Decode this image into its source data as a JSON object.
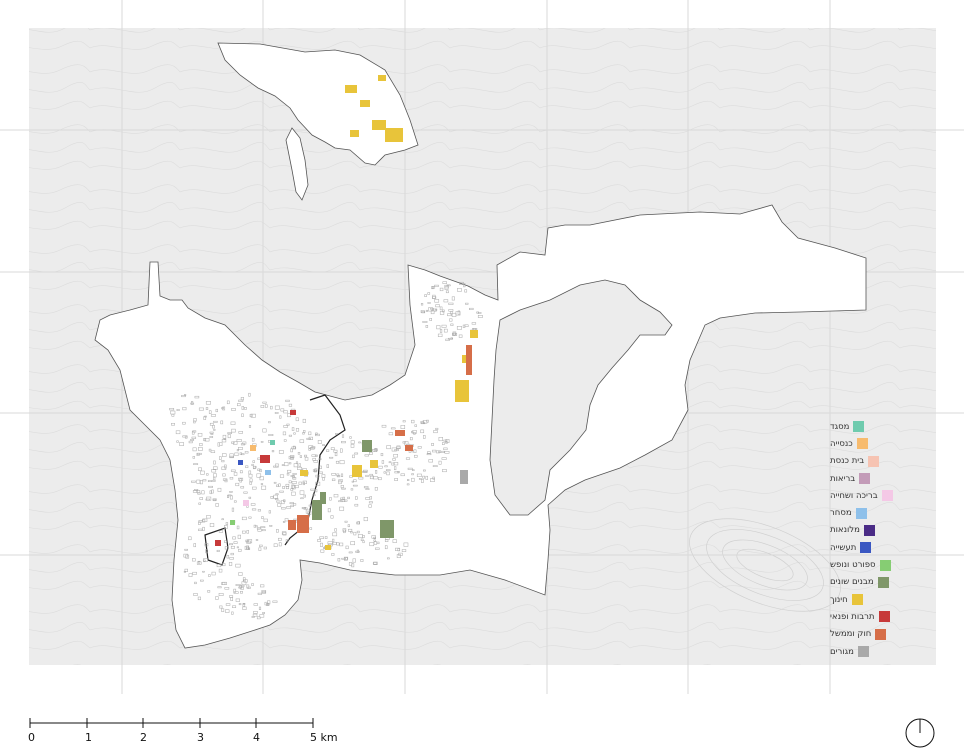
{
  "legend": {
    "items": [
      {
        "label": "מסגד",
        "color": "#6fcbae"
      },
      {
        "label": "כנסייה",
        "color": "#f7bb6e"
      },
      {
        "label": "בית כנסת",
        "color": "#f6c3b2"
      },
      {
        "label": "בריאות",
        "color": "#c39bb8"
      },
      {
        "label": "בריכה ושחייה",
        "color": "#f4c8e6"
      },
      {
        "label": "מסחר",
        "color": "#8ec0ea"
      },
      {
        "label": "מלונאות",
        "color": "#4a2b86"
      },
      {
        "label": "תעשייה",
        "color": "#3a57c2"
      },
      {
        "label": "ספורט ונופש",
        "color": "#86cd73"
      },
      {
        "label": "מבנים שונים",
        "color": "#7f9769"
      },
      {
        "label": "חינוך",
        "color": "#e8c43a"
      },
      {
        "label": "תרבות ופנאי",
        "color": "#c73a3a"
      },
      {
        "label": "חוק וממשל",
        "color": "#d66e48"
      },
      {
        "label": "מגורים",
        "color": "#a9a9a9"
      }
    ]
  },
  "scale_bar": {
    "labels": [
      "0",
      "1",
      "2",
      "3",
      "4",
      "5 km"
    ]
  },
  "colors": {
    "terrain": "#ececec",
    "contour": "#dadada",
    "grid": "#d9d9d9",
    "municipal_area": "#ffffff",
    "buildings": "#a9a9a9"
  },
  "north_arrow": {
    "icon": "north-arrow-icon"
  }
}
